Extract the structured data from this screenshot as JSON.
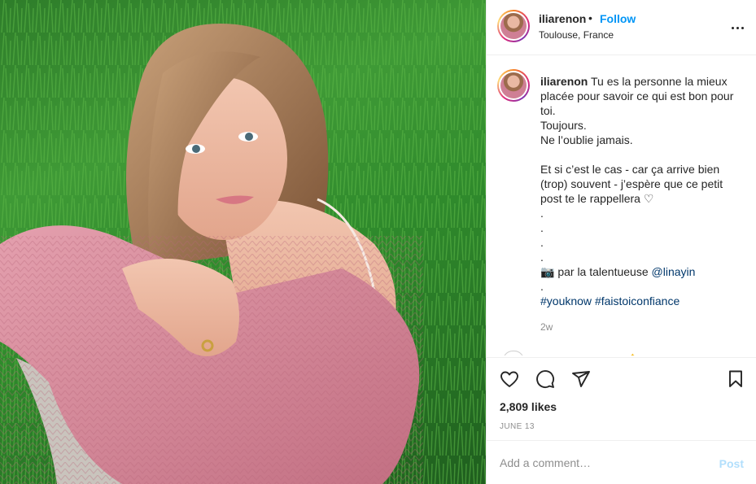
{
  "header": {
    "username": "iliarenon",
    "separator": "•",
    "follow_label": "Follow",
    "location": "Toulouse, France",
    "more_icon": "more-horizontal-icon"
  },
  "caption": {
    "username": "iliarenon",
    "lines": [
      "Tu es la personne la mieux placée pour savoir ce qui est bon pour toi.",
      "Toujours.",
      "Ne l’oublie jamais.",
      "",
      "Et si c’est le cas - car ça arrive bien (trop) souvent - j’espère que ce petit post te le rappellera ♡",
      ".",
      ".",
      ".",
      "."
    ],
    "credit_prefix": "📷 par la talentueuse",
    "credit_mention": "@linayin",
    "credit_dot": ".",
    "hashtag_1": "#youknow",
    "hashtag_2": "#faistoiconfiance",
    "time_ago": "2w"
  },
  "actions": {
    "icons": [
      "heart-icon",
      "comment-icon",
      "share-icon",
      "bookmark-icon"
    ],
    "likes": "2,809 likes",
    "date": "JUNE 13"
  },
  "comment": {
    "placeholder": "Add a comment…",
    "post_label": "Post"
  },
  "colors": {
    "accent": "#0095f6",
    "link": "#00376b",
    "muted": "#8e8e8e",
    "post_disabled": "#b2dffc",
    "sweater": "#d98a9b"
  }
}
